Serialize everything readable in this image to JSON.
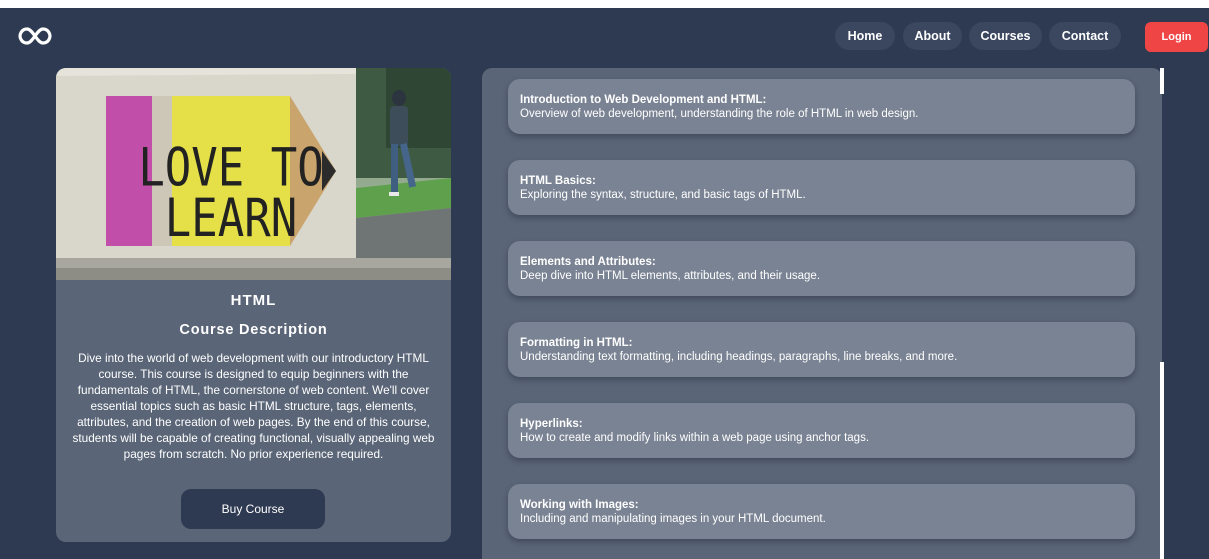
{
  "nav": {
    "links": [
      {
        "label": "Home"
      },
      {
        "label": "About"
      },
      {
        "label": "Courses"
      },
      {
        "label": "Contact"
      }
    ],
    "login_label": "Login",
    "logo_icon": "infinity-icon"
  },
  "course": {
    "image_text": "LOVE TO LEARN",
    "title": "HTML",
    "subtitle": "Course Description",
    "description": "Dive into the world of web development with our introductory HTML course. This course is designed to equip beginners with the fundamentals of HTML, the cornerstone of web content. We'll cover essential topics such as basic HTML structure, tags, elements, attributes, and the creation of web pages. By the end of this course, students will be capable of creating functional, visually appealing web pages from scratch. No prior experience required.",
    "buy_label": "Buy Course"
  },
  "modules": [
    {
      "title": "Introduction to Web Development and HTML:",
      "desc": "Overview of web development, understanding the role of HTML in web design."
    },
    {
      "title": "HTML Basics:",
      "desc": "Exploring the syntax, structure, and basic tags of HTML."
    },
    {
      "title": "Elements and Attributes:",
      "desc": "Deep dive into HTML elements, attributes, and their usage."
    },
    {
      "title": "Formatting in HTML:",
      "desc": "Understanding text formatting, including headings, paragraphs, line breaks, and more."
    },
    {
      "title": "Hyperlinks:",
      "desc": "How to create and modify links within a web page using anchor tags."
    },
    {
      "title": "Working with Images:",
      "desc": "Including and manipulating images in your HTML document."
    }
  ],
  "colors": {
    "background": "#2d3a52",
    "card": "#5a6577",
    "module": "#7a8393",
    "accent": "#ef4545"
  }
}
